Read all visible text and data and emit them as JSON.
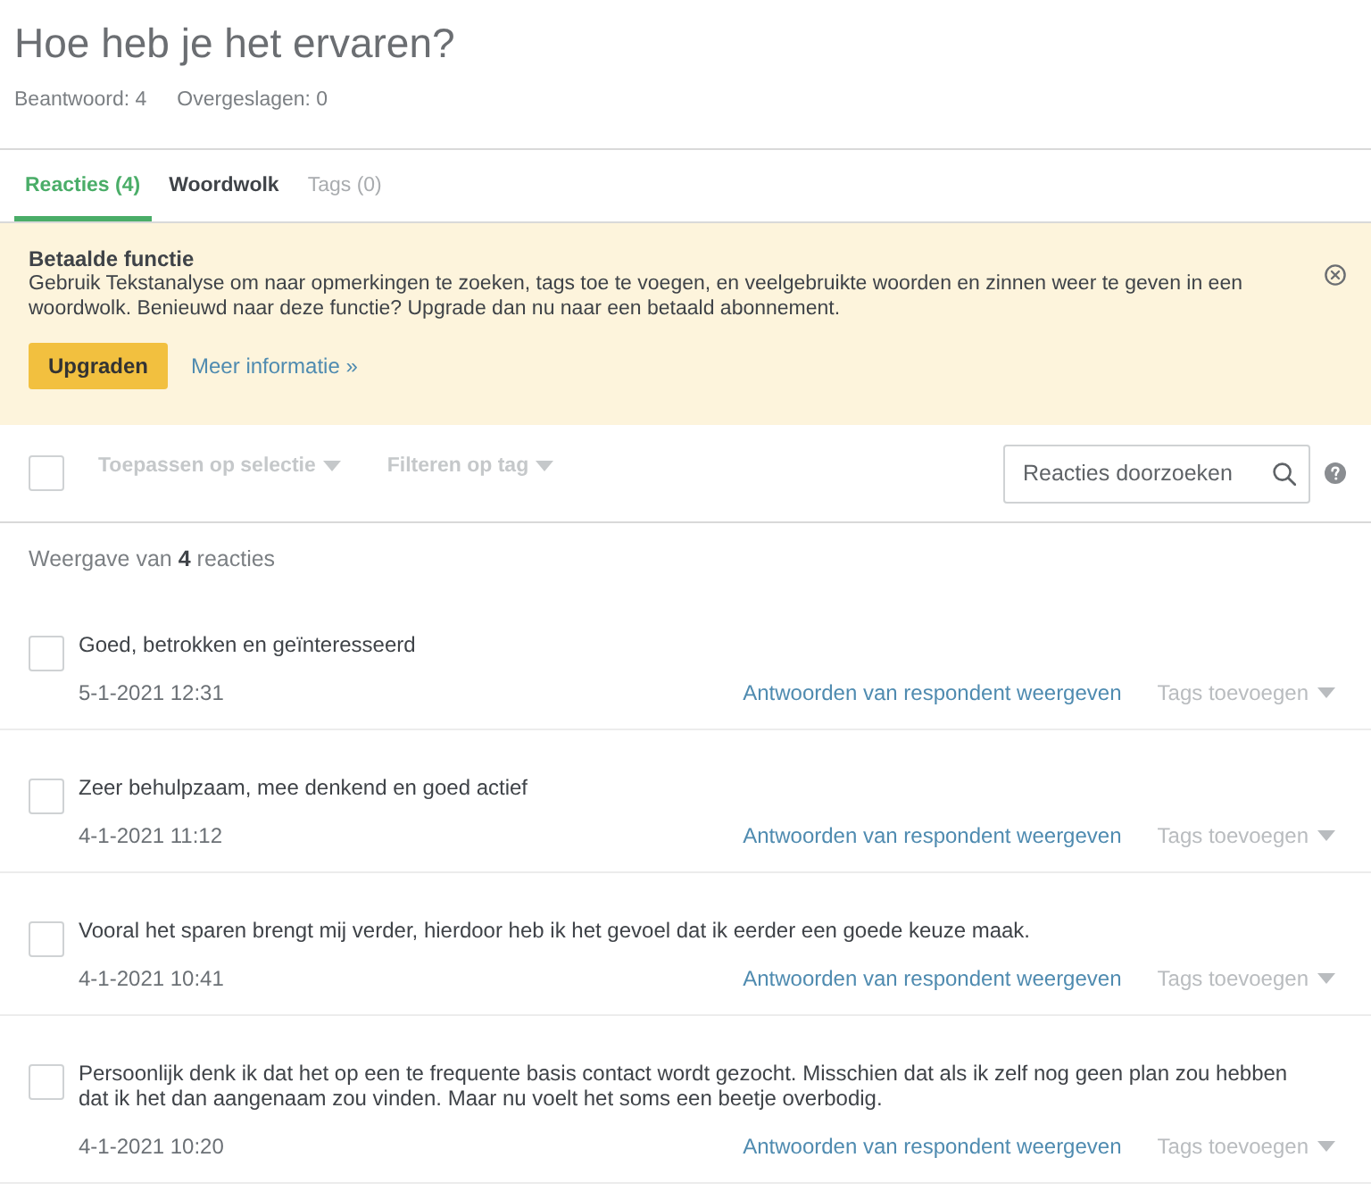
{
  "header": {
    "title": "Hoe heb je het ervaren?",
    "stats": [
      "Beantwoord: 4",
      "Overgeslagen: 0"
    ]
  },
  "tabs": [
    {
      "label": "Reacties (4)",
      "selected": true,
      "disabled": false
    },
    {
      "label": "Woordwolk",
      "selected": false,
      "disabled": false
    },
    {
      "label": "Tags (0)",
      "selected": false,
      "disabled": true
    }
  ],
  "banner": {
    "title": "Betaalde functie",
    "text": "Gebruik Tekstanalyse om naar opmerkingen te zoeken, tags toe te voegen, en veelgebruikte woorden en zinnen weer te geven in een woordwolk. Benieuwd naar deze functie? Upgrade dan nu naar een betaald abonnement.",
    "button": "Upgraden",
    "link": "Meer informatie »"
  },
  "toolbar": {
    "select_all": {
      "checked": false
    },
    "actions": [
      {
        "label": "Toepassen op selectie",
        "disabled": true
      },
      {
        "label": "Filteren op tag",
        "disabled": true
      }
    ],
    "search": {
      "placeholder": "Reacties doorzoeken"
    }
  },
  "summary": "Weergave van **4** reacties",
  "responses": [
    {
      "checked": false,
      "text": "Goed, betrokken en geïnteresseerd",
      "date": "5-1-2021 12:31",
      "link": "Antwoorden van respondent weergeven",
      "tag_menu": {
        "label": "Tags toevoegen",
        "disabled": true
      }
    },
    {
      "checked": false,
      "text": "Zeer behulpzaam, mee denkend en goed actief",
      "date": "4-1-2021 11:12",
      "link": "Antwoorden van respondent weergeven",
      "tag_menu": {
        "label": "Tags toevoegen",
        "disabled": true
      }
    },
    {
      "checked": false,
      "text": "Vooral het sparen brengt mij verder, hierdoor heb ik het gevoel dat ik eerder een goede keuze maak.",
      "date": "4-1-2021 10:41",
      "link": "Antwoorden van respondent weergeven",
      "tag_menu": {
        "label": "Tags toevoegen",
        "disabled": true
      }
    },
    {
      "checked": false,
      "text": "Persoonlijk denk ik dat het op een te frequente basis contact wordt gezocht. Misschien dat als ik zelf nog geen plan zou hebben dat ik het dan aangenaam zou vinden. Maar nu voelt het soms een beetje overbodig.",
      "date": "4-1-2021 10:20",
      "link": "Antwoorden van respondent weergeven",
      "tag_menu": {
        "label": "Tags toevoegen",
        "disabled": true
      }
    }
  ]
}
